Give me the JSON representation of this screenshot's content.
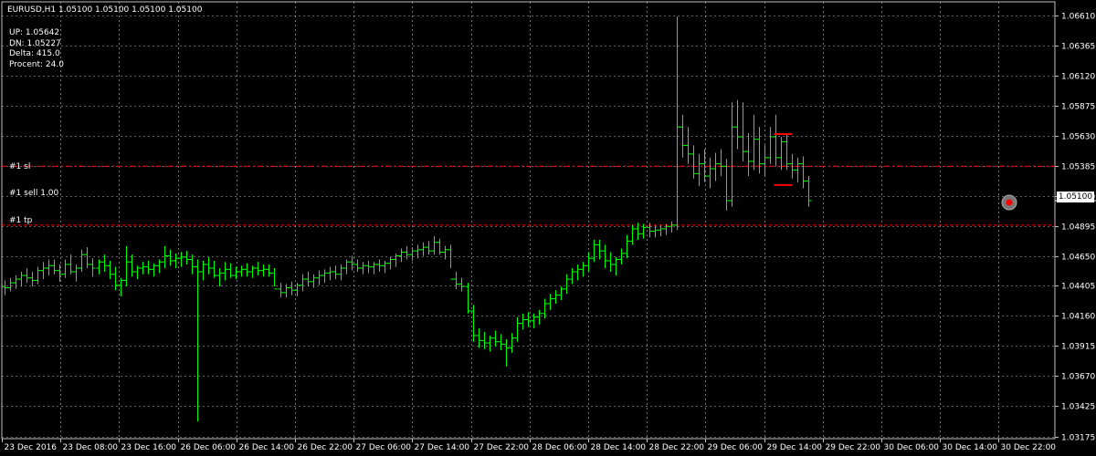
{
  "chart_header": {
    "symbol_line": "EURUSD,H1  1.05100 1.05100 1.05100 1.05100",
    "info": [
      "UP: 1.05642",
      "DN: 1.05227",
      "Delta: 415.0",
      "Procent: 24.0"
    ]
  },
  "levels": {
    "sl_label": "#1 sl",
    "sell_label": "#1 sell 1.00",
    "tp_label": "#1 tp"
  },
  "current_price_tag": "1.05100",
  "colors": {
    "background": "#000000",
    "grid": "#c0c0c0",
    "candles": "#00ff00",
    "sl_line": "#ff0000",
    "tp_line": "#ff0000",
    "markers": "#ff0000"
  },
  "chart_data": {
    "type": "ohlc-bars",
    "symbol": "EURUSD",
    "timeframe": "H1",
    "y_ticks": [
      "1.06610",
      "1.06365",
      "1.06120",
      "1.05875",
      "1.05630",
      "1.05385",
      "1.05140",
      "1.04895",
      "1.04650",
      "1.04405",
      "1.04160",
      "1.03915",
      "1.03670",
      "1.03425",
      "1.03175"
    ],
    "ylim": [
      1.0316,
      1.0672
    ],
    "x_ticks": [
      "23 Dec 2016",
      "23 Dec 08:00",
      "23 Dec 16:00",
      "26 Dec 06:00",
      "26 Dec 14:00",
      "26 Dec 22:00",
      "27 Dec 06:00",
      "27 Dec 14:00",
      "27 Dec 22:00",
      "28 Dec 06:00",
      "28 Dec 14:00",
      "28 Dec 22:00",
      "29 Dec 06:00",
      "29 Dec 14:00",
      "29 Dec 22:00",
      "30 Dec 06:00",
      "30 Dec 14:00",
      "30 Dec 22:00"
    ],
    "levels": {
      "sl": 1.0538,
      "sell": 1.051,
      "tp": 1.049,
      "up": 1.05642,
      "dn": 1.05227
    },
    "bars": [
      [
        1.044,
        1.0445,
        1.0433,
        1.0439
      ],
      [
        1.0439,
        1.0447,
        1.0436,
        1.0443
      ],
      [
        1.0443,
        1.0449,
        1.0438,
        1.0446
      ],
      [
        1.0446,
        1.0452,
        1.044,
        1.0449
      ],
      [
        1.0449,
        1.0455,
        1.0443,
        1.0447
      ],
      [
        1.0447,
        1.0452,
        1.044,
        1.0445
      ],
      [
        1.0445,
        1.0456,
        1.0442,
        1.0453
      ],
      [
        1.0453,
        1.046,
        1.0446,
        1.0455
      ],
      [
        1.0455,
        1.0462,
        1.0449,
        1.0457
      ],
      [
        1.0457,
        1.0462,
        1.045,
        1.0453
      ],
      [
        1.0453,
        1.0458,
        1.0444,
        1.045
      ],
      [
        1.045,
        1.0462,
        1.0447,
        1.0458
      ],
      [
        1.0458,
        1.0466,
        1.045,
        1.0452
      ],
      [
        1.0452,
        1.0458,
        1.0444,
        1.0455
      ],
      [
        1.0455,
        1.047,
        1.0452,
        1.0466
      ],
      [
        1.0466,
        1.0472,
        1.0455,
        1.0458
      ],
      [
        1.0458,
        1.0463,
        1.0448,
        1.0455
      ],
      [
        1.0455,
        1.0462,
        1.045,
        1.046
      ],
      [
        1.046,
        1.0466,
        1.0452,
        1.0457
      ],
      [
        1.0457,
        1.0461,
        1.0446,
        1.045
      ],
      [
        1.045,
        1.0456,
        1.0437,
        1.0441
      ],
      [
        1.0441,
        1.0447,
        1.0432,
        1.0445
      ],
      [
        1.0445,
        1.0473,
        1.044,
        1.046
      ],
      [
        1.046,
        1.0466,
        1.0448,
        1.0452
      ],
      [
        1.0452,
        1.0457,
        1.0446,
        1.0455
      ],
      [
        1.0455,
        1.046,
        1.045,
        1.0456
      ],
      [
        1.0456,
        1.0461,
        1.045,
        1.0454
      ],
      [
        1.0454,
        1.0459,
        1.0448,
        1.0457
      ],
      [
        1.0457,
        1.0462,
        1.0451,
        1.046
      ],
      [
        1.046,
        1.0473,
        1.0455,
        1.0465
      ],
      [
        1.0465,
        1.047,
        1.0457,
        1.0461
      ],
      [
        1.0461,
        1.0467,
        1.0455,
        1.0463
      ],
      [
        1.0463,
        1.0468,
        1.0456,
        1.0464
      ],
      [
        1.0464,
        1.0469,
        1.0458,
        1.0462
      ],
      [
        1.0462,
        1.0466,
        1.045,
        1.0456
      ],
      [
        1.0456,
        1.0462,
        1.033,
        1.0452
      ],
      [
        1.0452,
        1.0461,
        1.0445,
        1.0458
      ],
      [
        1.0458,
        1.0464,
        1.045,
        1.0455
      ],
      [
        1.0455,
        1.0461,
        1.0447,
        1.0449
      ],
      [
        1.0449,
        1.0455,
        1.044,
        1.0451
      ],
      [
        1.0451,
        1.046,
        1.0445,
        1.0454
      ],
      [
        1.0454,
        1.0459,
        1.0447,
        1.0449
      ],
      [
        1.0449,
        1.0456,
        1.0446,
        1.0452
      ],
      [
        1.0452,
        1.0457,
        1.0448,
        1.0454
      ],
      [
        1.0454,
        1.0459,
        1.0448,
        1.0452
      ],
      [
        1.0452,
        1.0457,
        1.0447,
        1.0455
      ],
      [
        1.0455,
        1.046,
        1.0449,
        1.0453
      ],
      [
        1.0453,
        1.0458,
        1.0448,
        1.0454
      ],
      [
        1.0454,
        1.0458,
        1.0448,
        1.0451
      ],
      [
        1.0451,
        1.0455,
        1.044,
        1.0438
      ],
      [
        1.0438,
        1.0443,
        1.0431,
        1.0435
      ],
      [
        1.0435,
        1.0442,
        1.0431,
        1.0439
      ],
      [
        1.0439,
        1.0444,
        1.0433,
        1.0437
      ],
      [
        1.0437,
        1.0443,
        1.0432,
        1.0441
      ],
      [
        1.0441,
        1.045,
        1.0436,
        1.0446
      ],
      [
        1.0446,
        1.0452,
        1.044,
        1.0444
      ],
      [
        1.0444,
        1.045,
        1.0439,
        1.0447
      ],
      [
        1.0447,
        1.0453,
        1.0441,
        1.0449
      ],
      [
        1.0449,
        1.0454,
        1.0443,
        1.0451
      ],
      [
        1.0451,
        1.0456,
        1.0445,
        1.0452
      ],
      [
        1.0452,
        1.0457,
        1.0446,
        1.045
      ],
      [
        1.045,
        1.0458,
        1.0445,
        1.0455
      ],
      [
        1.0455,
        1.0462,
        1.045,
        1.046
      ],
      [
        1.046,
        1.0465,
        1.0453,
        1.0458
      ],
      [
        1.0458,
        1.0462,
        1.0452,
        1.0455
      ],
      [
        1.0455,
        1.046,
        1.045,
        1.0457
      ],
      [
        1.0457,
        1.0461,
        1.0451,
        1.0456
      ],
      [
        1.0456,
        1.046,
        1.045,
        1.0458
      ],
      [
        1.0458,
        1.0462,
        1.0452,
        1.0457
      ],
      [
        1.0457,
        1.0461,
        1.0451,
        1.0459
      ],
      [
        1.0459,
        1.0464,
        1.0454,
        1.0462
      ],
      [
        1.0462,
        1.0467,
        1.0456,
        1.0465
      ],
      [
        1.0465,
        1.0471,
        1.046,
        1.0468
      ],
      [
        1.0468,
        1.0473,
        1.0462,
        1.0466
      ],
      [
        1.0466,
        1.0472,
        1.0461,
        1.0469
      ],
      [
        1.0469,
        1.0474,
        1.0463,
        1.047
      ],
      [
        1.047,
        1.0476,
        1.0465,
        1.0472
      ],
      [
        1.0472,
        1.0477,
        1.0466,
        1.0469
      ],
      [
        1.0469,
        1.0481,
        1.0466,
        1.0476
      ],
      [
        1.0476,
        1.0479,
        1.0466,
        1.0468
      ],
      [
        1.0468,
        1.0473,
        1.0462,
        1.047
      ],
      [
        1.047,
        1.0474,
        1.0455,
        1.0446
      ],
      [
        1.0446,
        1.0452,
        1.0438,
        1.0442
      ],
      [
        1.0442,
        1.0447,
        1.0436,
        1.044
      ],
      [
        1.044,
        1.0443,
        1.0418,
        1.042
      ],
      [
        1.042,
        1.0425,
        1.0395,
        1.04
      ],
      [
        1.04,
        1.0406,
        1.039,
        1.0396
      ],
      [
        1.0396,
        1.0403,
        1.0389,
        1.0394
      ],
      [
        1.0394,
        1.04,
        1.0387,
        1.0398
      ],
      [
        1.0398,
        1.0404,
        1.0391,
        1.0395
      ],
      [
        1.0395,
        1.0401,
        1.0388,
        1.0393
      ],
      [
        1.0393,
        1.0397,
        1.0375,
        1.039
      ],
      [
        1.039,
        1.0402,
        1.0386,
        1.0398
      ],
      [
        1.0398,
        1.0415,
        1.0395,
        1.041
      ],
      [
        1.041,
        1.0418,
        1.0405,
        1.0413
      ],
      [
        1.0413,
        1.0419,
        1.0407,
        1.0412
      ],
      [
        1.0412,
        1.0418,
        1.0406,
        1.0415
      ],
      [
        1.0415,
        1.0421,
        1.0409,
        1.0418
      ],
      [
        1.0418,
        1.043,
        1.0414,
        1.0426
      ],
      [
        1.0426,
        1.0434,
        1.0421,
        1.043
      ],
      [
        1.043,
        1.0437,
        1.0426,
        1.0433
      ],
      [
        1.0433,
        1.044,
        1.0429,
        1.0438
      ],
      [
        1.0438,
        1.045,
        1.0434,
        1.0446
      ],
      [
        1.0446,
        1.0455,
        1.0442,
        1.0452
      ],
      [
        1.0452,
        1.0458,
        1.0445,
        1.0454
      ],
      [
        1.0454,
        1.046,
        1.0448,
        1.0457
      ],
      [
        1.0457,
        1.0468,
        1.0452,
        1.0463
      ],
      [
        1.0463,
        1.0478,
        1.046,
        1.0474
      ],
      [
        1.0474,
        1.0478,
        1.0462,
        1.0469
      ],
      [
        1.0469,
        1.0474,
        1.0455,
        1.0461
      ],
      [
        1.0461,
        1.0468,
        1.0452,
        1.0458
      ],
      [
        1.0458,
        1.0464,
        1.0449,
        1.0462
      ],
      [
        1.0462,
        1.0471,
        1.0458,
        1.0467
      ],
      [
        1.0467,
        1.0482,
        1.0463,
        1.0477
      ],
      [
        1.0477,
        1.049,
        1.0474,
        1.0487
      ],
      [
        1.0487,
        1.0492,
        1.0478,
        1.0483
      ],
      [
        1.0483,
        1.0491,
        1.0479,
        1.0488
      ],
      [
        1.0488,
        1.0492,
        1.048,
        1.0485
      ],
      [
        1.0485,
        1.049,
        1.048,
        1.0486
      ],
      [
        1.0486,
        1.049,
        1.0481,
        1.0487
      ],
      [
        1.0487,
        1.0491,
        1.0482,
        1.0489
      ],
      [
        1.0489,
        1.0493,
        1.0484,
        1.049
      ],
      [
        1.049,
        1.066,
        1.0486,
        1.057
      ],
      [
        1.057,
        1.058,
        1.0545,
        1.0555
      ],
      [
        1.0555,
        1.057,
        1.054,
        1.0548
      ],
      [
        1.0548,
        1.0555,
        1.0528,
        1.0532
      ],
      [
        1.0532,
        1.0548,
        1.0522,
        1.054
      ],
      [
        1.054,
        1.0552,
        1.0525,
        1.053
      ],
      [
        1.053,
        1.0545,
        1.052,
        1.0536
      ],
      [
        1.0536,
        1.0549,
        1.0526,
        1.054
      ],
      [
        1.054,
        1.0552,
        1.053,
        1.0538
      ],
      [
        1.0538,
        1.0544,
        1.0502,
        1.051
      ],
      [
        1.051,
        1.059,
        1.0505,
        1.057
      ],
      [
        1.057,
        1.0592,
        1.0552,
        1.0562
      ],
      [
        1.0562,
        1.059,
        1.0542,
        1.055
      ],
      [
        1.055,
        1.0565,
        1.053,
        1.0542
      ],
      [
        1.0542,
        1.058,
        1.0535,
        1.056
      ],
      [
        1.056,
        1.057,
        1.0532,
        1.054
      ],
      [
        1.054,
        1.0555,
        1.053,
        1.0545
      ],
      [
        1.0545,
        1.057,
        1.054,
        1.0562
      ],
      [
        1.0562,
        1.058,
        1.0538,
        1.0545
      ],
      [
        1.0545,
        1.0562,
        1.0535,
        1.0558
      ],
      [
        1.0558,
        1.0565,
        1.0535,
        1.054
      ],
      [
        1.054,
        1.0548,
        1.0528,
        1.0535
      ],
      [
        1.0535,
        1.0545,
        1.0525,
        1.054
      ],
      [
        1.054,
        1.0546,
        1.052,
        1.0526
      ],
      [
        1.0526,
        1.053,
        1.0505,
        1.051
      ]
    ]
  }
}
